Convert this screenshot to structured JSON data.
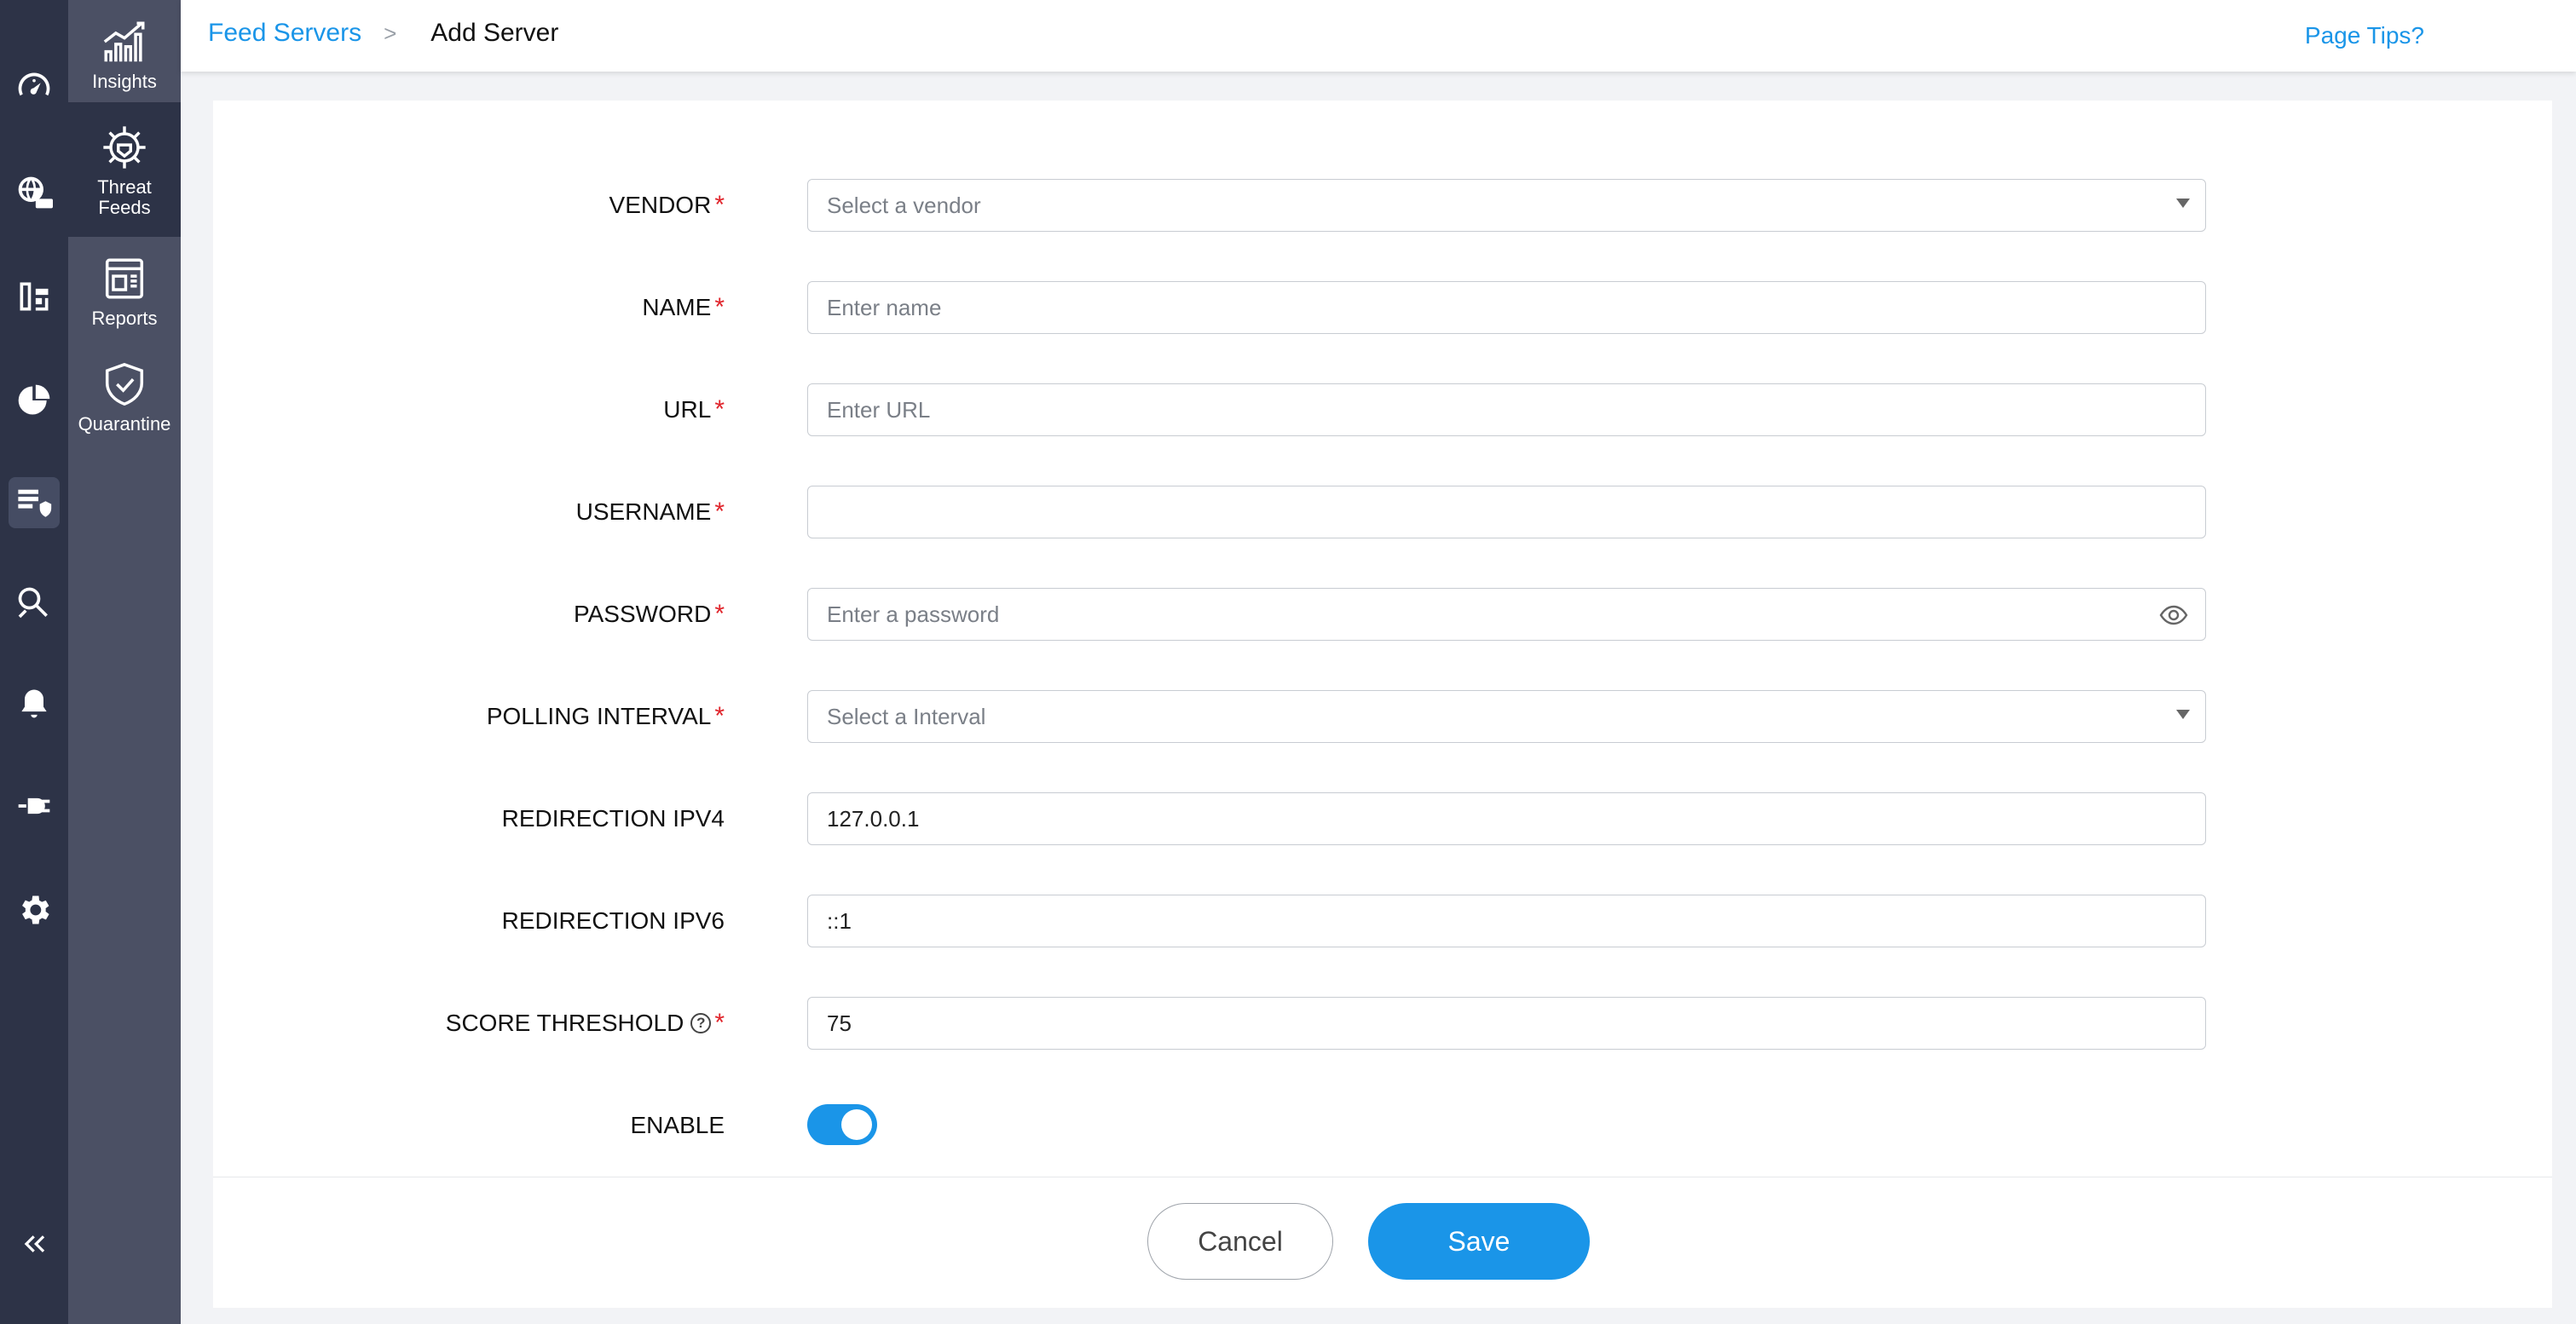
{
  "rail": {
    "items": [
      {
        "name": "dashboard-gauge-icon"
      },
      {
        "name": "dns-globe-icon"
      },
      {
        "name": "network-topology-icon"
      },
      {
        "name": "analytics-pie-icon"
      },
      {
        "name": "threat-server-shield-icon",
        "active": true
      },
      {
        "name": "investigate-search-icon"
      },
      {
        "name": "alerts-bell-icon"
      },
      {
        "name": "integrations-plug-icon"
      },
      {
        "name": "settings-wrench-gear-icon"
      }
    ],
    "collapse_icon": "collapse-double-chevron-icon"
  },
  "subnav": {
    "items": [
      {
        "label": "Insights",
        "icon": "insights-chart-icon"
      },
      {
        "label": "Threat\nFeeds",
        "icon": "threat-feeds-virus-icon",
        "active": true
      },
      {
        "label": "Reports",
        "icon": "reports-document-icon"
      },
      {
        "label": "Quarantine",
        "icon": "quarantine-shield-check-icon"
      }
    ]
  },
  "header": {
    "breadcrumb_parent": "Feed Servers",
    "breadcrumb_separator": ">",
    "breadcrumb_current": "Add Server",
    "page_tips": "Page Tips?"
  },
  "form": {
    "vendor": {
      "label": "VENDOR",
      "required": true,
      "placeholder": "Select a vendor"
    },
    "name": {
      "label": "NAME",
      "required": true,
      "placeholder": "Enter name"
    },
    "url": {
      "label": "URL",
      "required": true,
      "placeholder": "Enter URL"
    },
    "username": {
      "label": "USERNAME",
      "required": true,
      "value": ""
    },
    "password": {
      "label": "PASSWORD",
      "required": true,
      "placeholder": "Enter a password"
    },
    "polling_interval": {
      "label": "POLLING INTERVAL",
      "required": true,
      "placeholder": "Select a Interval"
    },
    "redirection_ipv4": {
      "label": "REDIRECTION IPV4",
      "value": "127.0.0.1"
    },
    "redirection_ipv6": {
      "label": "REDIRECTION IPV6",
      "value": "::1"
    },
    "score_threshold": {
      "label": "SCORE THRESHOLD",
      "required": true,
      "value": "75",
      "help": "?"
    },
    "enable": {
      "label": "ENABLE",
      "on": true
    },
    "required_marker": "*"
  },
  "footer": {
    "cancel_label": "Cancel",
    "save_label": "Save"
  },
  "colors": {
    "accent": "#1a95e8",
    "required": "#e0242b",
    "rail_bg": "#2d3347",
    "subnav_bg": "#4b5064"
  }
}
